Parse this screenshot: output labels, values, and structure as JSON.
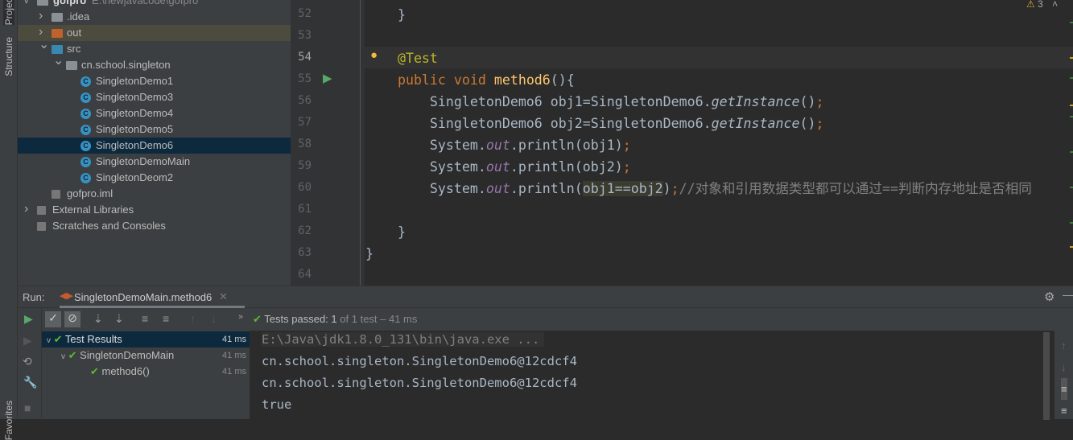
{
  "stripe": {
    "project_tab": "Project",
    "structure_tab": "Structure",
    "favorites_tab": "Favorites"
  },
  "tree": {
    "root": {
      "name": "gofpro",
      "path": "E:\\newjavacode\\gofpro"
    },
    "items": [
      {
        "label": ".idea",
        "type": "folder",
        "color": "#8a9196",
        "depth": 1,
        "arrow": ">"
      },
      {
        "label": "out",
        "type": "folder",
        "color": "#c0622d",
        "depth": 1,
        "arrow": ">"
      },
      {
        "label": "src",
        "type": "folder",
        "color": "#3a87b0",
        "depth": 1,
        "arrow": "v"
      },
      {
        "label": "cn.school.singleton",
        "type": "package",
        "color": "#8a9196",
        "depth": 2,
        "arrow": "v"
      },
      {
        "label": "SingletonDemo1",
        "type": "class",
        "depth": 3
      },
      {
        "label": "SingletonDemo3",
        "type": "class",
        "depth": 3
      },
      {
        "label": "SingletonDemo4",
        "type": "class",
        "depth": 3
      },
      {
        "label": "SingletonDemo5",
        "type": "class",
        "depth": 3
      },
      {
        "label": "SingletonDemo6",
        "type": "class",
        "depth": 3,
        "selected": true
      },
      {
        "label": "SingletonDemoMain",
        "type": "class",
        "depth": 3
      },
      {
        "label": "SingletonDeom2",
        "type": "class",
        "depth": 3
      },
      {
        "label": "gofpro.iml",
        "type": "file",
        "depth": 1
      },
      {
        "label": "External Libraries",
        "type": "lib",
        "depth": 0,
        "arrow": ">"
      },
      {
        "label": "Scratches and Consoles",
        "type": "scratch",
        "depth": 0
      }
    ]
  },
  "editor": {
    "warnings": "3",
    "lines": [
      {
        "n": "52",
        "seg": [
          [
            "pl",
            "    }"
          ]
        ]
      },
      {
        "n": "53",
        "seg": []
      },
      {
        "n": "54",
        "seg": [
          [
            "an",
            "    @Test"
          ]
        ],
        "current": true
      },
      {
        "n": "55",
        "seg": [
          [
            "kw",
            "    public void "
          ],
          [
            "fn",
            "method6"
          ],
          [
            "pl",
            "(){"
          ]
        ],
        "run": true
      },
      {
        "n": "56",
        "seg": [
          [
            "pl",
            "        SingletonDemo6 obj1=SingletonDemo6."
          ],
          [
            "itn",
            "getInstance"
          ],
          [
            "pl",
            "()"
          ],
          [
            "kw",
            ";"
          ]
        ]
      },
      {
        "n": "57",
        "seg": [
          [
            "pl",
            "        SingletonDemo6 obj2=SingletonDemo6."
          ],
          [
            "itn",
            "getInstance"
          ],
          [
            "pl",
            "()"
          ],
          [
            "kw",
            ";"
          ]
        ]
      },
      {
        "n": "58",
        "seg": [
          [
            "pl",
            "        System."
          ],
          [
            "it",
            "out"
          ],
          [
            "pl",
            ".println(obj1)"
          ],
          [
            "kw",
            ";"
          ]
        ]
      },
      {
        "n": "59",
        "seg": [
          [
            "pl",
            "        System."
          ],
          [
            "it",
            "out"
          ],
          [
            "pl",
            ".println(obj2)"
          ],
          [
            "kw",
            ";"
          ]
        ]
      },
      {
        "n": "60",
        "seg": [
          [
            "pl",
            "        System."
          ],
          [
            "it",
            "out"
          ],
          [
            "pl",
            ".println("
          ],
          [
            "hlv",
            "obj1==obj2"
          ],
          [
            "pl",
            ")"
          ],
          [
            "kw",
            ";"
          ],
          [
            "cm",
            "//对象和引用数据类型都可以通过==判断内存地址是否相同"
          ]
        ]
      },
      {
        "n": "61",
        "seg": []
      },
      {
        "n": "62",
        "seg": [
          [
            "pl",
            "    }"
          ]
        ]
      },
      {
        "n": "63",
        "seg": [
          [
            "pl",
            "}"
          ]
        ]
      },
      {
        "n": "64",
        "seg": []
      }
    ]
  },
  "run": {
    "label": "Run:",
    "tab": "SingletonDemoMain.method6",
    "status_prefix": "Tests passed:",
    "status_count": "1",
    "status_rest": "of 1 test – 41 ms",
    "results": [
      {
        "label": "Test Results",
        "time": "41 ms"
      },
      {
        "label": "SingletonDemoMain",
        "time": "41 ms"
      },
      {
        "label": "method6()",
        "time": "41 ms"
      }
    ],
    "console": [
      "E:\\Java\\jdk1.8.0_131\\bin\\java.exe ...",
      "cn.school.singleton.SingletonDemo6@12cdcf4",
      "cn.school.singleton.SingletonDemo6@12cdcf4",
      "true"
    ]
  }
}
